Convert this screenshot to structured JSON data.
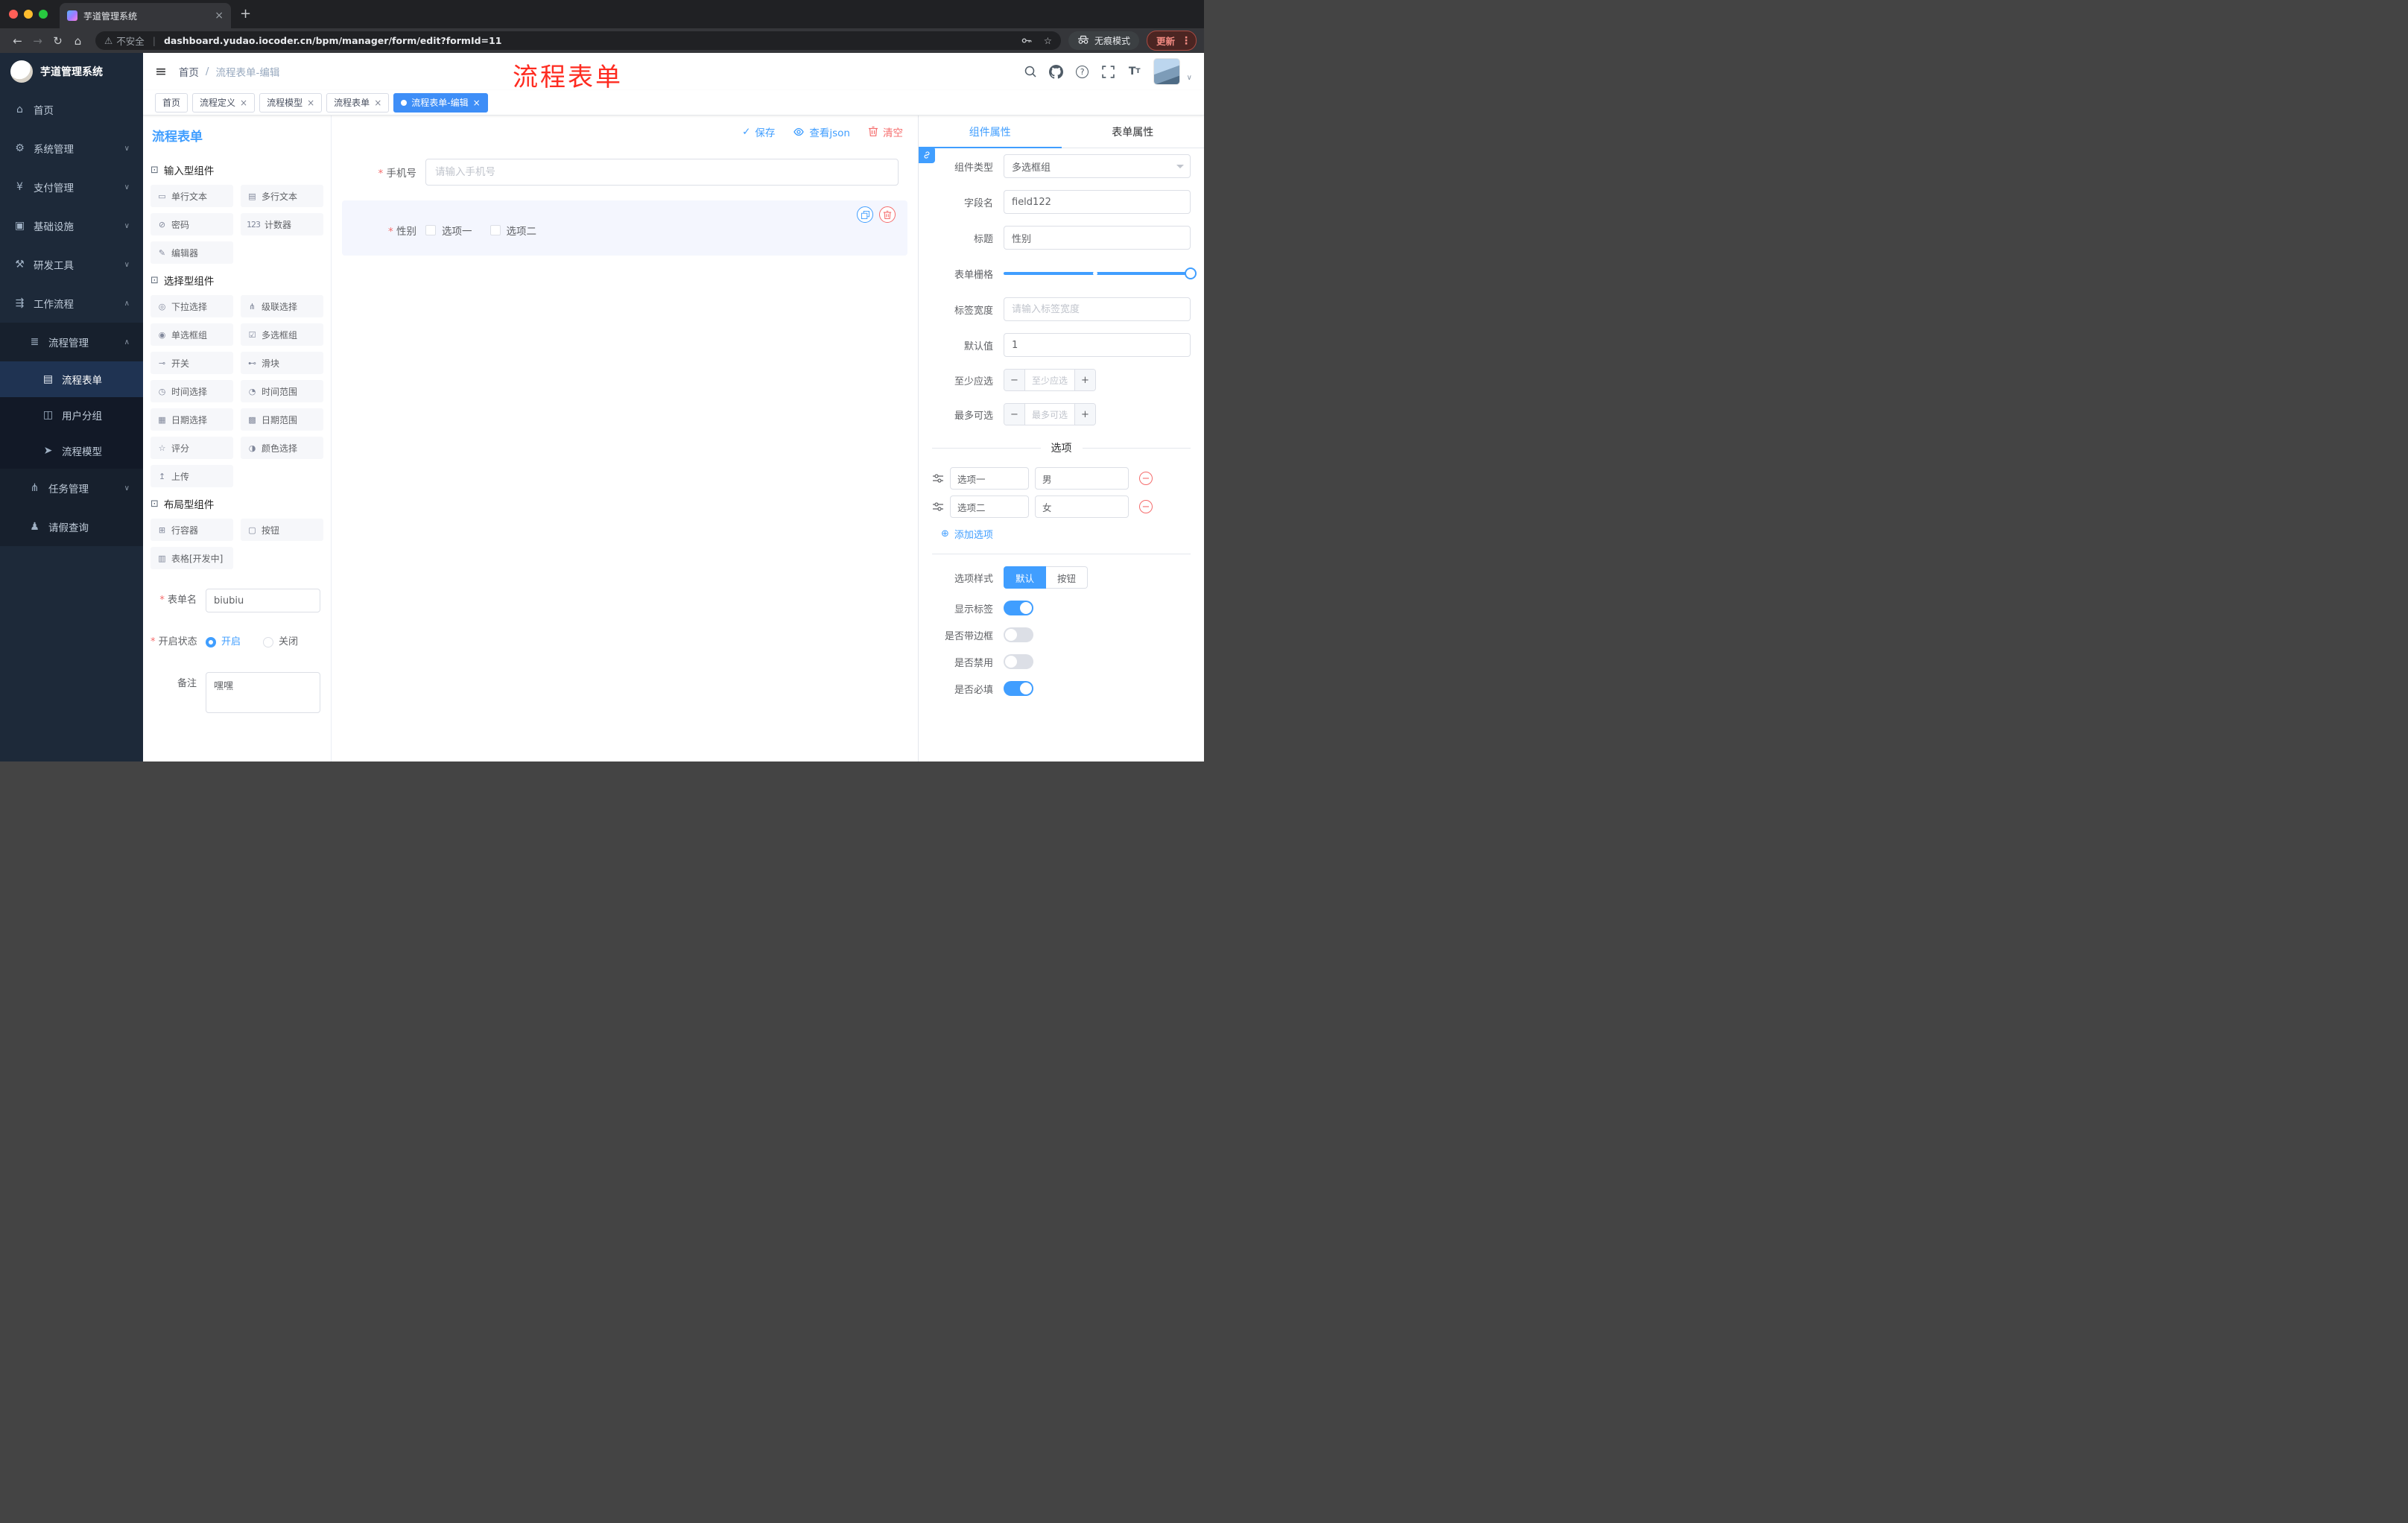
{
  "colors": {
    "accent": "#409eff",
    "danger": "#f56c6c",
    "watermark_red": "#fe2b20",
    "sidebar_bg": "#1d2939",
    "active_tag_bg": "#3e8ef7"
  },
  "icons": {
    "back": "←",
    "forward": "→",
    "reload": "↻",
    "home": "⌂",
    "star": "☆",
    "kebab": "⋮",
    "warning": "⚠",
    "close": "×",
    "new_tab": "+",
    "hamburger": "≡",
    "breadcrumb_sep": "/",
    "chevron_down": "∨",
    "chevron_up": "∧",
    "check": "✓",
    "minus": "−",
    "plus": "+",
    "add_circle": "⊕",
    "group_cube": "⊡",
    "copy": "⧉"
  },
  "browser": {
    "tab_title": "芋道管理系统",
    "security_label": "不安全",
    "url": "dashboard.yudao.iocoder.cn/bpm/manager/form/edit?formId=11",
    "incognito_label": "无痕模式",
    "update_button": "更新"
  },
  "sidebar": {
    "logo_title": "芋道管理系统",
    "items": [
      {
        "label": "首页",
        "glyph": "⌂"
      },
      {
        "label": "系统管理",
        "glyph": "⚙"
      },
      {
        "label": "支付管理",
        "glyph": "¥"
      },
      {
        "label": "基础设施",
        "glyph": "▣"
      },
      {
        "label": "研发工具",
        "glyph": "⚒"
      },
      {
        "label": "工作流程",
        "glyph": "⇶"
      }
    ],
    "process_management": {
      "label": "流程管理",
      "glyph": "≣"
    },
    "process_children": [
      {
        "label": "流程表单",
        "glyph": "▤",
        "active": true
      },
      {
        "label": "用户分组",
        "glyph": "◫",
        "active": false
      },
      {
        "label": "流程模型",
        "glyph": "➤",
        "active": false
      }
    ],
    "task_management": {
      "label": "任务管理",
      "glyph": "⋔"
    },
    "leave_query": {
      "label": "请假查询",
      "glyph": "♟"
    }
  },
  "header": {
    "breadcrumb_home": "首页",
    "breadcrumb_current": "流程表单-编辑",
    "watermark": "流程表单"
  },
  "tags": [
    {
      "label": "首页",
      "closable": false,
      "active": false
    },
    {
      "label": "流程定义",
      "closable": true,
      "active": false
    },
    {
      "label": "流程模型",
      "closable": true,
      "active": false
    },
    {
      "label": "流程表单",
      "closable": true,
      "active": false
    },
    {
      "label": "流程表单-编辑",
      "closable": true,
      "active": true
    }
  ],
  "editor": {
    "panel_title": "流程表单",
    "toolbar": {
      "save": "保存",
      "view_json": "查看json",
      "clear": "清空"
    },
    "groups": [
      {
        "title": "输入型组件",
        "items": [
          {
            "label": "单行文本",
            "glyph": "▭"
          },
          {
            "label": "多行文本",
            "glyph": "▤"
          },
          {
            "label": "密码",
            "glyph": "⊘"
          },
          {
            "label": "计数器",
            "glyph": "123"
          },
          {
            "label": "编辑器",
            "glyph": "✎"
          }
        ]
      },
      {
        "title": "选择型组件",
        "items": [
          {
            "label": "下拉选择",
            "glyph": "◎"
          },
          {
            "label": "级联选择",
            "glyph": "⋔"
          },
          {
            "label": "单选框组",
            "glyph": "◉"
          },
          {
            "label": "多选框组",
            "glyph": "☑"
          },
          {
            "label": "开关",
            "glyph": "⊸"
          },
          {
            "label": "滑块",
            "glyph": "⊷"
          },
          {
            "label": "时间选择",
            "glyph": "◷"
          },
          {
            "label": "时间范围",
            "glyph": "◔"
          },
          {
            "label": "日期选择",
            "glyph": "▦"
          },
          {
            "label": "日期范围",
            "glyph": "▩"
          },
          {
            "label": "评分",
            "glyph": "☆"
          },
          {
            "label": "颜色选择",
            "glyph": "◑"
          },
          {
            "label": "上传",
            "glyph": "↥"
          }
        ]
      },
      {
        "title": "布局型组件",
        "items": [
          {
            "label": "行容器",
            "glyph": "⊞"
          },
          {
            "label": "按钮",
            "glyph": "▢"
          },
          {
            "label": "表格[开发中]",
            "glyph": "▥"
          }
        ]
      }
    ],
    "meta": {
      "name_label": "表单名",
      "name_value": "biubiu",
      "status_label": "开启状态",
      "status_on": "开启",
      "status_off": "关闭",
      "status_selected": "开启",
      "remark_label": "备注",
      "remark_value": "嘿嘿"
    },
    "canvas": {
      "phone_label": "手机号",
      "phone_placeholder": "请输入手机号",
      "gender_label": "性别",
      "gender_option1": "选项一",
      "gender_option2": "选项二"
    }
  },
  "props": {
    "tab_component": "组件属性",
    "tab_form": "表单属性",
    "component_type_label": "组件类型",
    "component_type_value": "多选框组",
    "field_name_label": "字段名",
    "field_name_value": "field122",
    "title_label": "标题",
    "title_value": "性别",
    "grid_label": "表单栅格",
    "label_width_label": "标签宽度",
    "label_width_placeholder": "请输入标签宽度",
    "default_label": "默认值",
    "default_value": "1",
    "min_label": "至少应选",
    "min_placeholder": "至少应选",
    "max_label": "最多可选",
    "max_placeholder": "最多可选",
    "options_divider": "选项",
    "options": [
      {
        "label": "选项一",
        "value": "男"
      },
      {
        "label": "选项二",
        "value": "女"
      }
    ],
    "add_option": "添加选项",
    "option_style_label": "选项样式",
    "style_default": "默认",
    "style_button": "按钮",
    "style_selected": "默认",
    "toggles": [
      {
        "label": "显示标签",
        "on": true
      },
      {
        "label": "是否带边框",
        "on": false
      },
      {
        "label": "是否禁用",
        "on": false
      },
      {
        "label": "是否必填",
        "on": true
      }
    ]
  }
}
